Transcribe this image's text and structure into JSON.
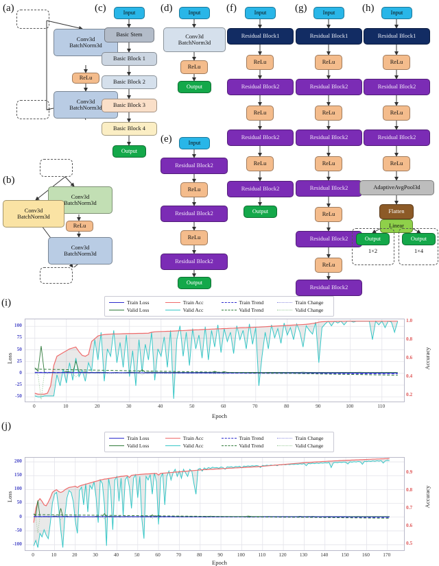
{
  "figure": {
    "panels": [
      "(a)",
      "(b)",
      "(c)",
      "(d)",
      "(e)",
      "(f)",
      "(g)",
      "(h)",
      "(i)",
      "(j)"
    ]
  },
  "labels": {
    "a": "(a)",
    "b": "(b)",
    "c": "(c)",
    "d": "(d)",
    "e": "(e)",
    "f": "(f)",
    "g": "(g)",
    "h": "(h)",
    "i": "(i)",
    "j": "(j)"
  },
  "nodes": {
    "input": "Input",
    "output": "Output",
    "relu": "ReLu",
    "conv_l1": "Conv3d",
    "conv_l2": "BatchNorm3d",
    "basic_stem": "Basic Stem",
    "basic_block1": "Basic Block 1",
    "basic_block2": "Basic Block 2",
    "basic_block3": "Basic Block 3",
    "basic_block4": "Basic Block 4",
    "res1": "Residual Block1",
    "res2": "Residual Block2",
    "pool": "AdaptiveAvgPool3d",
    "flatten": "Flatten",
    "linear": "Linear",
    "out_shape_a": "1×2",
    "out_shape_b": "1×4"
  },
  "chart_data": [
    {
      "id": "i",
      "type": "line",
      "title": "",
      "xlabel": "Epoch",
      "ylabel": "Loss",
      "y2label": "Accuracy",
      "xlim": [
        -3,
        117
      ],
      "ylim": [
        -60,
        115
      ],
      "y2lim": [
        0.13,
        1.02
      ],
      "xticks": [
        0,
        10,
        20,
        30,
        40,
        50,
        60,
        70,
        80,
        90,
        100,
        110
      ],
      "yticks": [
        -50,
        -25,
        0,
        25,
        50,
        75,
        100
      ],
      "y2ticks": [
        0.2,
        0.4,
        0.6,
        0.8,
        1.0
      ],
      "grid": true,
      "legend_position": "above-plot",
      "series": [
        {
          "name": "Train Loss",
          "color": "#2b2bcd",
          "style": "solid",
          "axis": "left"
        },
        {
          "name": "Valid Loss",
          "color": "#2f7a3a",
          "style": "solid",
          "axis": "left"
        },
        {
          "name": "Train Acc",
          "color": "#ef6a6a",
          "style": "solid",
          "axis": "right"
        },
        {
          "name": "Valid Acc",
          "color": "#36c7c7",
          "style": "solid",
          "axis": "right"
        },
        {
          "name": "Train Trend",
          "color": "#2b2bcd",
          "style": "dashed",
          "axis": "left"
        },
        {
          "name": "Valid Trend",
          "color": "#2f7a3a",
          "style": "dashed",
          "axis": "left"
        },
        {
          "name": "Train Change",
          "color": "#8f8fe0",
          "style": "dotted",
          "axis": "left"
        },
        {
          "name": "Valid Change",
          "color": "#9ccb9c",
          "style": "dotted",
          "axis": "left"
        }
      ],
      "train_acc": [
        0.22,
        0.21,
        0.21,
        0.21,
        0.22,
        0.3,
        0.52,
        0.62,
        0.64,
        0.66,
        0.68,
        0.7,
        0.71,
        0.72,
        0.67,
        0.63,
        0.62,
        0.64,
        0.78,
        0.81,
        0.84,
        0.85,
        0.855,
        0.858,
        0.86,
        0.862,
        0.862,
        0.863,
        0.864,
        0.865,
        0.866,
        0.866,
        0.867,
        0.868,
        0.868,
        0.869,
        0.87,
        0.88,
        0.885,
        0.887,
        0.888,
        0.889,
        0.89,
        0.891,
        0.893,
        0.895,
        0.897,
        0.898,
        0.9,
        0.902,
        0.904,
        0.906,
        0.907,
        0.909,
        0.911,
        0.912,
        0.914,
        0.915,
        0.917,
        0.918,
        0.92,
        0.921,
        0.923,
        0.924,
        0.926,
        0.928,
        0.929,
        0.93,
        0.932,
        0.933,
        0.935,
        0.936,
        0.938,
        0.94,
        0.942,
        0.944,
        0.946,
        0.948,
        0.95,
        0.952,
        0.954,
        0.956,
        0.958,
        0.96,
        0.962,
        0.964,
        0.966,
        0.97,
        0.975,
        0.98,
        0.99,
        0.994,
        0.996,
        0.997,
        0.998,
        0.998,
        0.999,
        0.999,
        0.999,
        1.0,
        1.0,
        1.0,
        1.0,
        1.0,
        1.0,
        1.0,
        1.0,
        1.0,
        1.0,
        1.0,
        1.0,
        1.0,
        1.0,
        1.0,
        1.0,
        1.0
      ],
      "valid_acc": [
        0.19,
        0.18,
        0.18,
        0.19,
        0.19,
        0.19,
        0.19,
        0.42,
        0.3,
        0.48,
        0.33,
        0.55,
        0.36,
        0.6,
        0.4,
        0.47,
        0.35,
        0.55,
        0.46,
        0.8,
        0.58,
        0.88,
        0.35,
        0.7,
        0.62,
        0.9,
        0.55,
        0.77,
        0.5,
        0.85,
        0.4,
        0.68,
        0.3,
        0.8,
        0.45,
        0.75,
        0.58,
        0.88,
        0.36,
        0.7,
        0.62,
        0.83,
        0.5,
        0.9,
        0.16,
        0.8,
        0.95,
        0.62,
        0.88,
        0.52,
        0.92,
        0.7,
        0.85,
        0.6,
        0.94,
        0.58,
        0.9,
        0.72,
        0.96,
        0.66,
        0.92,
        0.78,
        0.88,
        0.65,
        0.95,
        0.8,
        0.9,
        0.7,
        0.97,
        0.75,
        0.93,
        0.3,
        0.62,
        0.88,
        0.7,
        0.96,
        0.82,
        0.92,
        0.76,
        0.98,
        0.85,
        0.93,
        0.8,
        0.97,
        0.88,
        0.72,
        0.95,
        0.9,
        0.86,
        0.99,
        0.55,
        0.93,
        0.97,
        1.0,
        0.95,
        1.0,
        0.98,
        1.0,
        0.96,
        1.0,
        1.0,
        0.99,
        1.0,
        1.0,
        1.0,
        1.0,
        1.0,
        0.8,
        1.0,
        0.96,
        1.0,
        0.93,
        1.0,
        0.99,
        0.88,
        1.0
      ]
    },
    {
      "id": "j",
      "type": "line",
      "title": "",
      "xlabel": "Epoch",
      "ylabel": "Loss",
      "y2label": "Accuracy",
      "xlim": [
        -4,
        178
      ],
      "ylim": [
        -120,
        215
      ],
      "y2lim": [
        0.465,
        0.985
      ],
      "xticks": [
        0,
        10,
        20,
        30,
        40,
        50,
        60,
        70,
        80,
        90,
        100,
        110,
        120,
        130,
        140,
        150,
        160,
        170
      ],
      "yticks": [
        -100,
        -50,
        0,
        50,
        100,
        150,
        200
      ],
      "y2ticks": [
        0.5,
        0.6,
        0.7,
        0.8,
        0.9
      ],
      "grid": true,
      "legend_position": "above-plot",
      "series": [
        {
          "name": "Train Loss",
          "color": "#2b2bcd",
          "style": "solid",
          "axis": "left"
        },
        {
          "name": "Valid Loss",
          "color": "#2f7a3a",
          "style": "solid",
          "axis": "left"
        },
        {
          "name": "Train Acc",
          "color": "#ef6a6a",
          "style": "solid",
          "axis": "right"
        },
        {
          "name": "Valid Acc",
          "color": "#36c7c7",
          "style": "solid",
          "axis": "right"
        },
        {
          "name": "Train Trend",
          "color": "#2b2bcd",
          "style": "dashed",
          "axis": "left"
        },
        {
          "name": "Valid Trend",
          "color": "#2f7a3a",
          "style": "dashed",
          "axis": "left"
        },
        {
          "name": "Train Change",
          "color": "#8f8fe0",
          "style": "dotted",
          "axis": "left"
        },
        {
          "name": "Valid Change",
          "color": "#9ccb9c",
          "style": "dotted",
          "axis": "left"
        }
      ],
      "train_acc": [
        0.62,
        0.7,
        0.74,
        0.755,
        0.74,
        0.72,
        0.715,
        0.735,
        0.76,
        0.79,
        0.8,
        0.805,
        0.795,
        0.79,
        0.795,
        0.805,
        0.812,
        0.818,
        0.82,
        0.822,
        0.825,
        0.818,
        0.826,
        0.83,
        0.833,
        0.836,
        0.84,
        0.843,
        0.846,
        0.85,
        0.853,
        0.856,
        0.86,
        0.862,
        0.865,
        0.866,
        0.868,
        0.87,
        0.872,
        0.874,
        0.876,
        0.878,
        0.88,
        0.881,
        0.883,
        0.884,
        0.874,
        0.886,
        0.888,
        0.889,
        0.89,
        0.891,
        0.892,
        0.893,
        0.894,
        0.894,
        0.895,
        0.896,
        0.896,
        0.897,
        0.888,
        0.897,
        0.898,
        0.899,
        0.9,
        0.901,
        0.902,
        0.903,
        0.904,
        0.905,
        0.906,
        0.907,
        0.908,
        0.909,
        0.91,
        0.911,
        0.912,
        0.913,
        0.914,
        0.915,
        0.916,
        0.917,
        0.918,
        0.918,
        0.919,
        0.92,
        0.92,
        0.921,
        0.922,
        0.922,
        0.923,
        0.924,
        0.924,
        0.925,
        0.926,
        0.926,
        0.927,
        0.928,
        0.928,
        0.929,
        0.93,
        0.93,
        0.931,
        0.932,
        0.932,
        0.933,
        0.934,
        0.934,
        0.935,
        0.936,
        0.937,
        0.938,
        0.939,
        0.94,
        0.941,
        0.942,
        0.943,
        0.944,
        0.945,
        0.946,
        0.947,
        0.948,
        0.949,
        0.95,
        0.951,
        0.952,
        0.953,
        0.954,
        0.955,
        0.956,
        0.957,
        0.958,
        0.958,
        0.959,
        0.96,
        0.961,
        0.962,
        0.962,
        0.963,
        0.964,
        0.964,
        0.965,
        0.966,
        0.966,
        0.967,
        0.968,
        0.968,
        0.969,
        0.969,
        0.97,
        0.97,
        0.971,
        0.971,
        0.972,
        0.972,
        0.973,
        0.973,
        0.974,
        0.974,
        0.975,
        0.975,
        0.976,
        0.976,
        0.977,
        0.977,
        0.978,
        0.978,
        0.979,
        0.979,
        0.98,
        0.98,
        0.981
      ],
      "valid_acc": [
        0.49,
        0.52,
        0.48,
        0.56,
        0.54,
        0.58,
        0.55,
        0.53,
        0.62,
        0.73,
        0.78,
        0.79,
        0.7,
        0.58,
        0.48,
        0.66,
        0.76,
        0.8,
        0.79,
        0.74,
        0.63,
        0.56,
        0.8,
        0.82,
        0.72,
        0.84,
        0.68,
        0.83,
        0.81,
        0.85,
        0.76,
        0.62,
        0.86,
        0.84,
        0.72,
        0.49,
        0.87,
        0.8,
        0.58,
        0.86,
        0.88,
        0.74,
        0.87,
        0.66,
        0.86,
        0.88,
        0.82,
        0.7,
        0.87,
        0.89,
        0.76,
        0.88,
        0.64,
        0.53,
        0.88,
        0.86,
        0.89,
        0.78,
        0.9,
        0.85,
        0.61,
        0.87,
        0.9,
        0.72,
        0.88,
        0.91,
        0.86,
        0.9,
        0.92,
        0.88,
        0.91,
        0.87,
        0.92,
        0.9,
        0.88,
        0.92,
        0.91,
        0.84,
        0.78,
        0.92,
        0.925,
        0.91,
        0.928,
        0.92,
        0.93,
        0.925,
        0.932,
        0.928,
        0.93,
        0.926,
        0.933,
        0.93,
        0.92,
        0.934,
        0.932,
        0.935,
        0.93,
        0.936,
        0.934,
        0.937,
        0.928,
        0.938,
        0.936,
        0.939,
        0.937,
        0.94,
        0.938,
        0.941,
        0.939,
        0.93,
        0.942,
        0.94,
        0.943,
        0.941,
        0.944,
        0.942,
        0.945,
        0.94,
        0.946,
        0.944,
        0.947,
        0.945,
        0.948,
        0.946,
        0.949,
        0.947,
        0.95,
        0.948,
        0.951,
        0.949,
        0.952,
        0.94,
        0.953,
        0.951,
        0.954,
        0.952,
        0.955,
        0.953,
        0.956,
        0.954,
        0.957,
        0.955,
        0.958,
        0.93,
        0.956,
        0.959,
        0.957,
        0.96,
        0.958,
        0.961,
        0.959,
        0.95,
        0.962,
        0.96,
        0.963,
        0.961,
        0.964,
        0.962,
        0.948,
        0.965,
        0.963,
        0.966,
        0.964,
        0.967,
        0.965,
        0.968,
        0.966,
        0.969,
        0.955,
        0.967,
        0.97,
        0.968,
        0.971
      ]
    }
  ]
}
